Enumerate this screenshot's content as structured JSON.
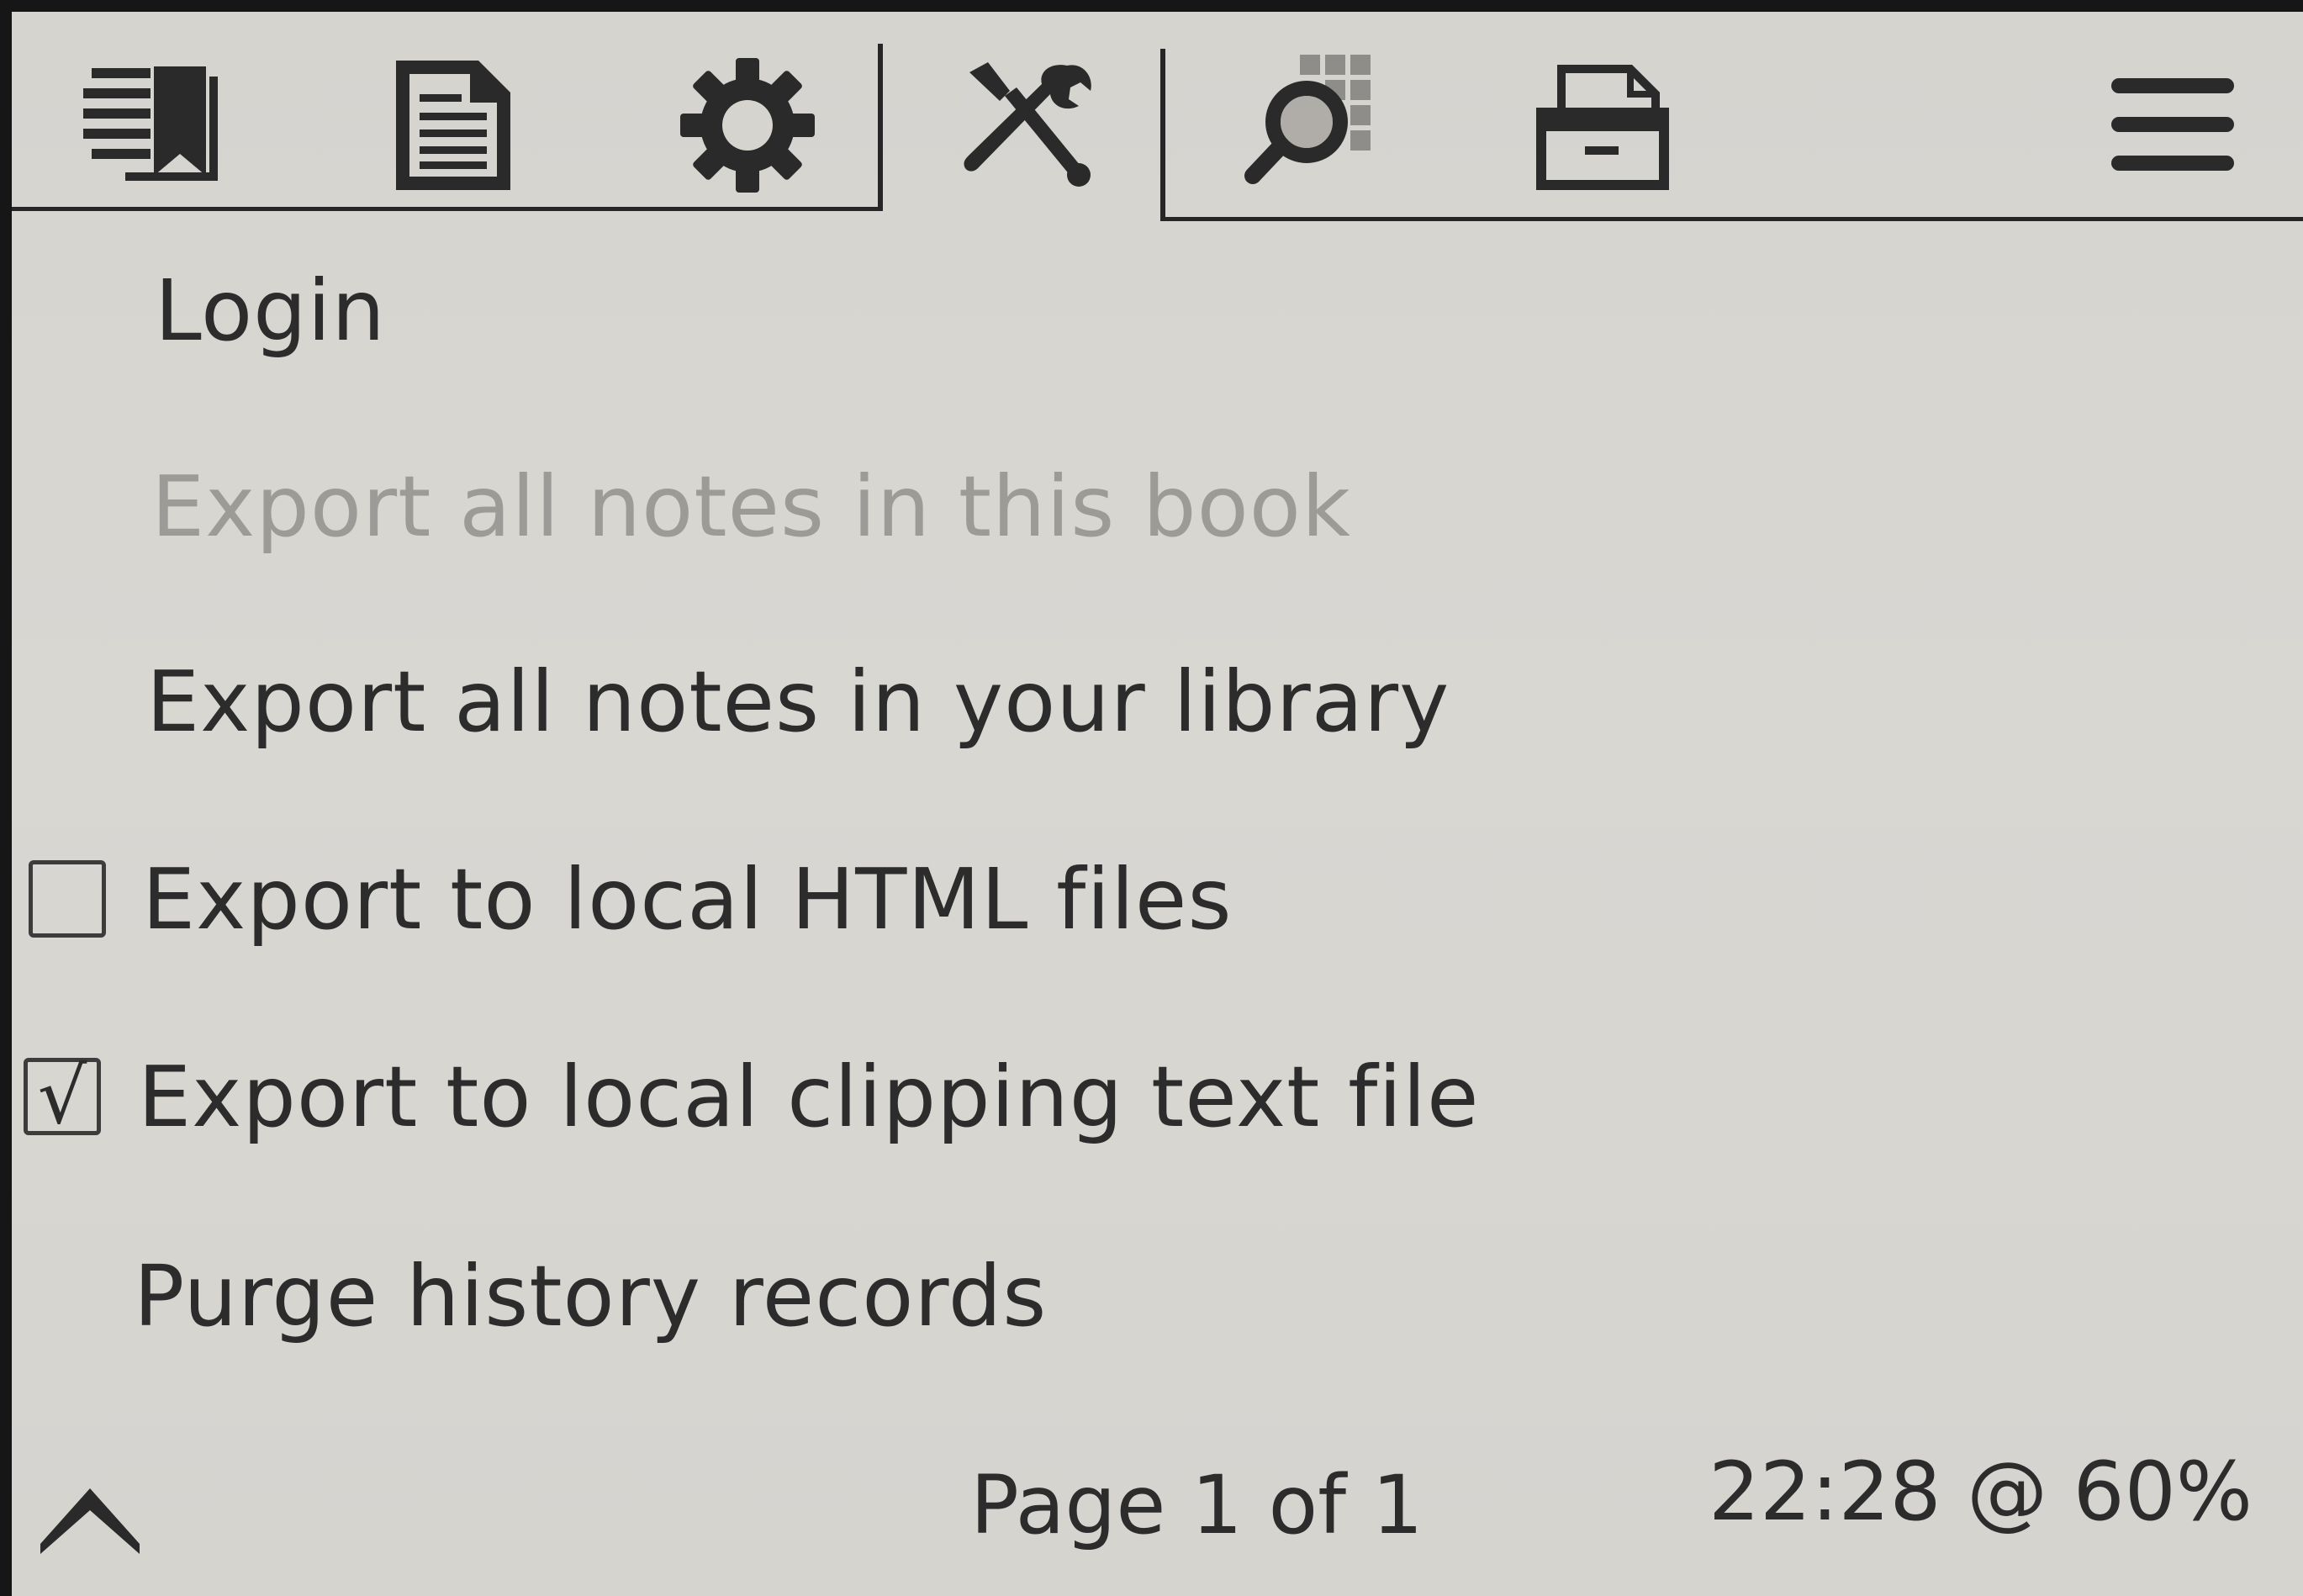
{
  "tabs": [
    {
      "name": "bookmarks",
      "icon": "bookmark-list-icon"
    },
    {
      "name": "document",
      "icon": "document-icon"
    },
    {
      "name": "settings",
      "icon": "gear-icon"
    },
    {
      "name": "tools",
      "icon": "tools-icon",
      "active": true
    },
    {
      "name": "search",
      "icon": "search-icon"
    },
    {
      "name": "file-manager",
      "icon": "cabinet-icon"
    },
    {
      "name": "main-menu",
      "icon": "hamburger-menu-icon"
    }
  ],
  "menu": {
    "items": [
      {
        "label": "Login",
        "enabled": true
      },
      {
        "label": "Export all notes in this book",
        "enabled": false
      },
      {
        "label": "Export all notes in your library",
        "enabled": true
      },
      {
        "label": "Export to local HTML files",
        "enabled": true,
        "checkbox": true,
        "checked": false,
        "mark": ""
      },
      {
        "label": "Export to local clipping text file",
        "enabled": true,
        "checkbox": true,
        "checked": true,
        "mark": "√"
      },
      {
        "label": "Purge history records",
        "enabled": true
      }
    ]
  },
  "footer": {
    "page_indicator": "Page 1 of 1",
    "status": "22:28 @ 60%",
    "up_icon": "chevron-up-icon"
  },
  "colors": {
    "background": "#d7d5d0",
    "text": "#2c2c2c",
    "disabled_text": "#9d9b97",
    "border": "#262626"
  }
}
